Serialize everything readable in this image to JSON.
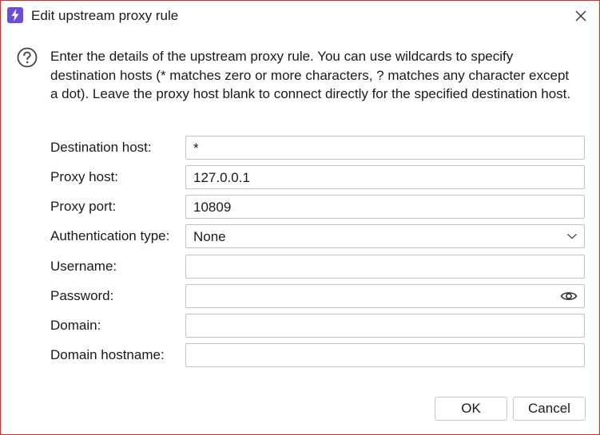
{
  "window": {
    "title": "Edit upstream proxy rule",
    "accent_color": "#6f4cd8",
    "border_color": "#d32f2f"
  },
  "info": {
    "text": "Enter the details of the upstream proxy rule. You can use wildcards to specify destination hosts (* matches zero or more characters, ? matches any character except a dot). Leave the proxy host blank to connect directly for the specified destination host."
  },
  "form": {
    "destination_host": {
      "label": "Destination host:",
      "value": "*"
    },
    "proxy_host": {
      "label": "Proxy host:",
      "value": "127.0.0.1"
    },
    "proxy_port": {
      "label": "Proxy port:",
      "value": "10809"
    },
    "auth_type": {
      "label": "Authentication type:",
      "value": "None"
    },
    "username": {
      "label": "Username:",
      "value": ""
    },
    "password": {
      "label": "Password:",
      "value": ""
    },
    "domain": {
      "label": "Domain:",
      "value": ""
    },
    "domain_hostname": {
      "label": "Domain hostname:",
      "value": ""
    }
  },
  "buttons": {
    "ok": "OK",
    "cancel": "Cancel"
  },
  "icons": {
    "app": "lightning-bolt-icon",
    "close": "close-icon",
    "help": "question-circle-icon",
    "dropdown": "chevron-down-icon",
    "reveal": "eye-icon"
  }
}
